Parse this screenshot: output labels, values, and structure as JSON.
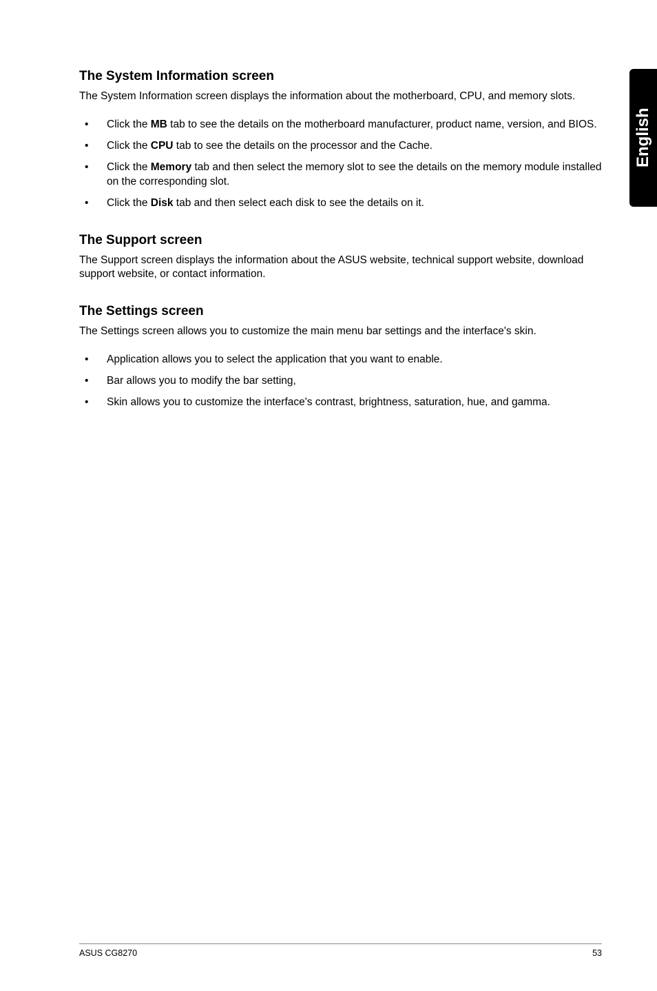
{
  "sideTab": "English",
  "sections": {
    "sysInfo": {
      "heading": "The System Information screen",
      "intro": "The System Information screen displays the information about the motherboard, CPU, and memory slots.",
      "items": {
        "mb": {
          "pre": "Click the ",
          "bold": "MB",
          "post": " tab to see the details on the motherboard manufacturer, product name, version, and BIOS."
        },
        "cpu": {
          "pre": "Click the ",
          "bold": "CPU",
          "post": " tab to see the details on the processor and the Cache."
        },
        "memory": {
          "pre": "Click the ",
          "bold": "Memory",
          "post": " tab and then select the memory slot to see the details on the memory module installed on the corresponding slot."
        },
        "disk": {
          "pre": "Click the ",
          "bold": "Disk",
          "post": " tab and then select each disk to see the details on it."
        }
      }
    },
    "support": {
      "heading": "The Support screen",
      "intro": "The Support screen displays the information about the ASUS website, technical support website, download support website, or contact information."
    },
    "settings": {
      "heading": "The Settings screen",
      "intro": "The Settings screen allows you to customize the main menu bar settings and the interface's skin.",
      "items": {
        "app": "Application allows you to select the application that you want to enable.",
        "bar": "Bar allows you to modify the bar setting,",
        "skin": "Skin allows you to customize the interface's contrast, brightness, saturation, hue, and gamma."
      }
    }
  },
  "footer": {
    "left": "ASUS CG8270",
    "right": "53"
  }
}
